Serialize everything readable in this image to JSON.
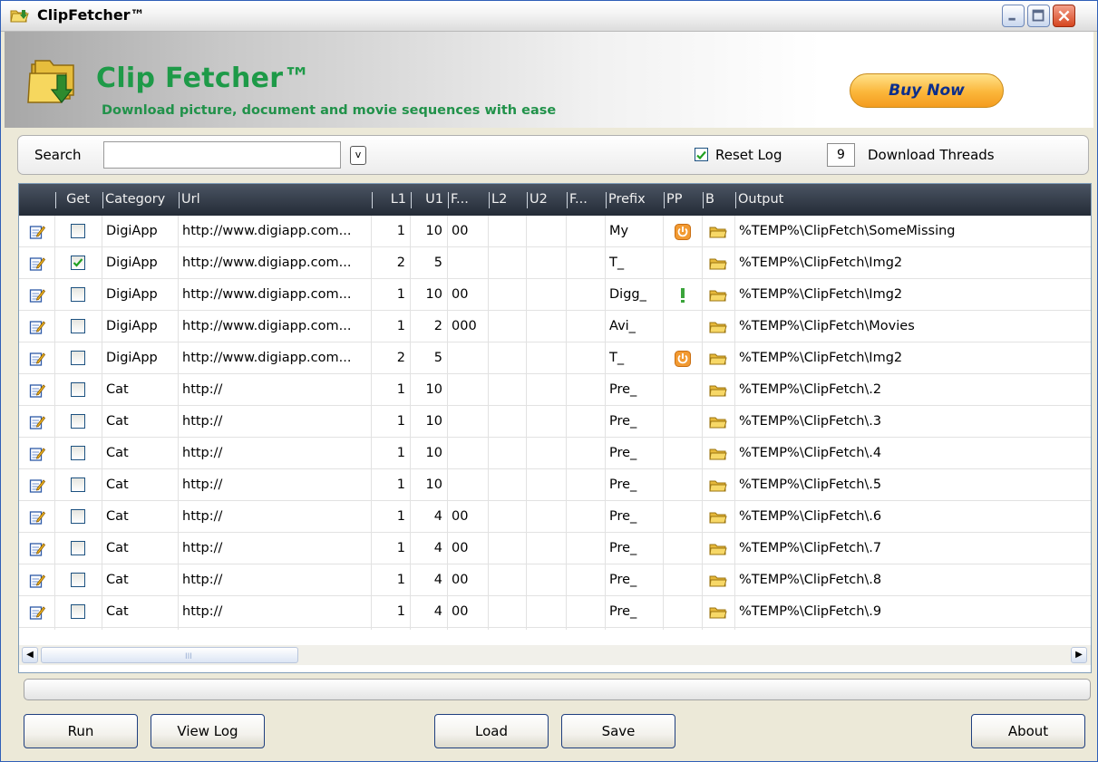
{
  "window": {
    "title": "ClipFetcher™"
  },
  "banner": {
    "brand": "Clip Fetcher™",
    "tagline": "Download picture, document and movie sequences with ease",
    "buy_label": "Buy Now"
  },
  "search": {
    "label": "Search",
    "value": "",
    "dropdown_glyph": "v",
    "reset_log_label": "Reset Log",
    "reset_log_checked": true,
    "threads_value": "9",
    "threads_label": "Download Threads"
  },
  "grid": {
    "columns": [
      "Get",
      "Category",
      "Url",
      "L1",
      "U1",
      "F...",
      "L2",
      "U2",
      "F...",
      "Prefix",
      "PP",
      "B",
      "Output"
    ],
    "rows": [
      {
        "get": false,
        "category": "DigiApp",
        "url": "http://www.digiapp.com...",
        "l1": "1",
        "u1": "10",
        "f1": "00",
        "l2": "",
        "u2": "",
        "f2": "",
        "prefix": "My",
        "pp": "power-icon",
        "output": "%TEMP%\\ClipFetch\\SomeMissing"
      },
      {
        "get": true,
        "category": "DigiApp",
        "url": "http://www.digiapp.com...",
        "l1": "2",
        "u1": "5",
        "f1": "",
        "l2": "",
        "u2": "",
        "f2": "",
        "prefix": "T_",
        "pp": "",
        "output": "%TEMP%\\ClipFetch\\Img2"
      },
      {
        "get": false,
        "category": "DigiApp",
        "url": "http://www.digiapp.com...",
        "l1": "1",
        "u1": "10",
        "f1": "00",
        "l2": "",
        "u2": "",
        "f2": "",
        "prefix": "Digg_",
        "pp": "exclamation-icon",
        "output": "%TEMP%\\ClipFetch\\Img2"
      },
      {
        "get": false,
        "category": "DigiApp",
        "url": "http://www.digiapp.com...",
        "l1": "1",
        "u1": "2",
        "f1": "000",
        "l2": "",
        "u2": "",
        "f2": "",
        "prefix": "Avi_",
        "pp": "",
        "output": "%TEMP%\\ClipFetch\\Movies"
      },
      {
        "get": false,
        "category": "DigiApp",
        "url": "http://www.digiapp.com...",
        "l1": "2",
        "u1": "5",
        "f1": "",
        "l2": "",
        "u2": "",
        "f2": "",
        "prefix": "T_",
        "pp": "power-icon",
        "output": "%TEMP%\\ClipFetch\\Img2"
      },
      {
        "get": false,
        "category": "Cat",
        "url": "http://",
        "l1": "1",
        "u1": "10",
        "f1": "",
        "l2": "",
        "u2": "",
        "f2": "",
        "prefix": "Pre_",
        "pp": "",
        "output": "%TEMP%\\ClipFetch\\.2"
      },
      {
        "get": false,
        "category": "Cat",
        "url": "http://",
        "l1": "1",
        "u1": "10",
        "f1": "",
        "l2": "",
        "u2": "",
        "f2": "",
        "prefix": "Pre_",
        "pp": "",
        "output": "%TEMP%\\ClipFetch\\.3"
      },
      {
        "get": false,
        "category": "Cat",
        "url": "http://",
        "l1": "1",
        "u1": "10",
        "f1": "",
        "l2": "",
        "u2": "",
        "f2": "",
        "prefix": "Pre_",
        "pp": "",
        "output": "%TEMP%\\ClipFetch\\.4"
      },
      {
        "get": false,
        "category": "Cat",
        "url": "http://",
        "l1": "1",
        "u1": "10",
        "f1": "",
        "l2": "",
        "u2": "",
        "f2": "",
        "prefix": "Pre_",
        "pp": "",
        "output": "%TEMP%\\ClipFetch\\.5"
      },
      {
        "get": false,
        "category": "Cat",
        "url": "http://",
        "l1": "1",
        "u1": "4",
        "f1": "00",
        "l2": "",
        "u2": "",
        "f2": "",
        "prefix": "Pre_",
        "pp": "",
        "output": "%TEMP%\\ClipFetch\\.6"
      },
      {
        "get": false,
        "category": "Cat",
        "url": "http://",
        "l1": "1",
        "u1": "4",
        "f1": "00",
        "l2": "",
        "u2": "",
        "f2": "",
        "prefix": "Pre_",
        "pp": "",
        "output": "%TEMP%\\ClipFetch\\.7"
      },
      {
        "get": false,
        "category": "Cat",
        "url": "http://",
        "l1": "1",
        "u1": "4",
        "f1": "00",
        "l2": "",
        "u2": "",
        "f2": "",
        "prefix": "Pre_",
        "pp": "",
        "output": "%TEMP%\\ClipFetch\\.8"
      },
      {
        "get": false,
        "category": "Cat",
        "url": "http://",
        "l1": "1",
        "u1": "4",
        "f1": "00",
        "l2": "",
        "u2": "",
        "f2": "",
        "prefix": "Pre_",
        "pp": "",
        "output": "%TEMP%\\ClipFetch\\.9"
      }
    ]
  },
  "scrollbar": {
    "grip_glyph": "III"
  },
  "buttons": {
    "run": "Run",
    "view_log": "View Log",
    "load": "Load",
    "save": "Save",
    "about": "About"
  },
  "colors": {
    "brand_green": "#1e9a48",
    "header_dark": "#2d3440",
    "buy_orange": "#f7a52a",
    "buy_text": "#0b2e8c"
  }
}
